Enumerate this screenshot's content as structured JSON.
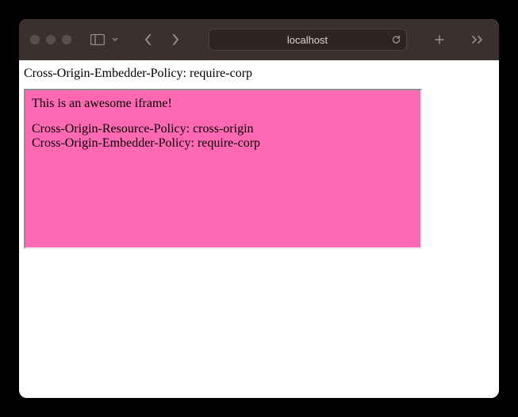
{
  "titlebar": {
    "url_display": "localhost"
  },
  "page": {
    "header_line": "Cross-Origin-Embedder-Policy: require-corp",
    "iframe": {
      "title": "This is an awesome iframe!",
      "line1": "Cross-Origin-Resource-Policy: cross-origin",
      "line2": "Cross-Origin-Embedder-Policy: require-corp"
    }
  },
  "colors": {
    "iframe_bg": "#ff69b4",
    "titlebar_bg": "#3b302e"
  }
}
